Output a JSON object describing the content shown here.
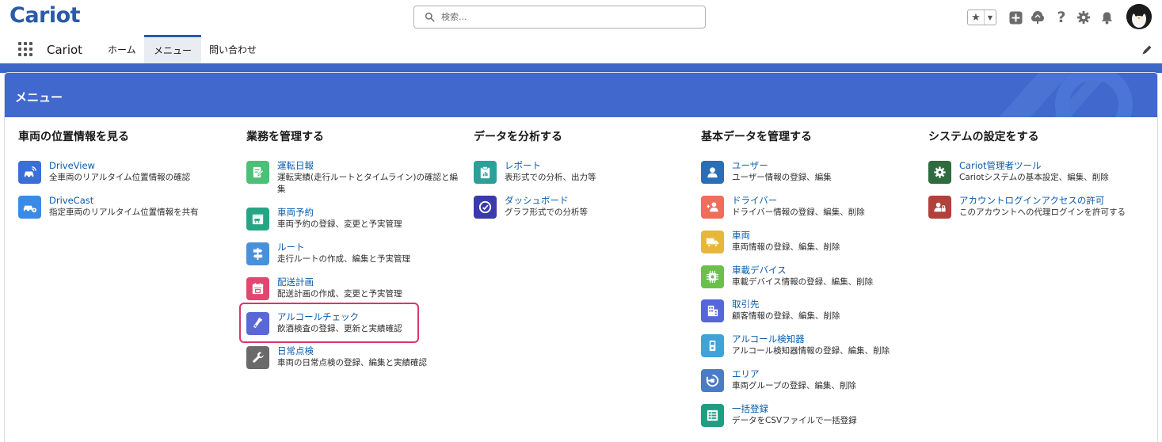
{
  "header": {
    "logo_text": "Cariot",
    "search_placeholder": "検索..."
  },
  "nav": {
    "app_name": "Cariot",
    "tabs": [
      {
        "label": "ホーム"
      },
      {
        "label": "メニュー",
        "active": true
      },
      {
        "label": "問い合わせ"
      }
    ]
  },
  "page": {
    "title": "メニュー"
  },
  "columns": [
    {
      "title": "車両の位置情報を見る",
      "items": [
        {
          "label": "DriveView",
          "desc": "全車両のリアルタイム位置情報の確認",
          "icon": "car-signal-icon",
          "color": "#3b6fd8"
        },
        {
          "label": "DriveCast",
          "desc": "指定車両のリアルタイム位置情報を共有",
          "icon": "car-share-icon",
          "color": "#3a8be6"
        }
      ]
    },
    {
      "title": "業務を管理する",
      "items": [
        {
          "label": "運転日報",
          "desc": "運転実績(走行ルートとタイムライン)の確認と編集",
          "icon": "report-edit-icon",
          "color": "#4bc076"
        },
        {
          "label": "車両予約",
          "desc": "車両予約の登録、変更と予実管理",
          "icon": "calendar-car-icon",
          "color": "#26a586"
        },
        {
          "label": "ルート",
          "desc": "走行ルートの作成、編集と予実管理",
          "icon": "route-sign-icon",
          "color": "#4a90d9"
        },
        {
          "label": "配送計画",
          "desc": "配送計画の作成、変更と予実管理",
          "icon": "calendar-icon",
          "color": "#e3466f"
        },
        {
          "label": "アルコールチェック",
          "desc": "飲酒検査の登録、更新と実績確認",
          "icon": "alcohol-tester-icon",
          "color": "#5a68d6"
        },
        {
          "label": "日常点検",
          "desc": "車両の日常点検の登録、編集と実績確認",
          "icon": "wrench-icon",
          "color": "#6a6a6a"
        }
      ]
    },
    {
      "title": "データを分析する",
      "items": [
        {
          "label": "レポート",
          "desc": "表形式での分析、出力等",
          "icon": "report-clipboard-icon",
          "color": "#2aa198"
        },
        {
          "label": "ダッシュボード",
          "desc": "グラフ形式での分析等",
          "icon": "gauge-icon",
          "color": "#3a3aa8"
        }
      ]
    },
    {
      "title": "基本データを管理する",
      "items": [
        {
          "label": "ユーザー",
          "desc": "ユーザー情報の登録、編集",
          "icon": "user-icon",
          "color": "#2a6eb8"
        },
        {
          "label": "ドライバー",
          "desc": "ドライバー情報の登録、編集、削除",
          "icon": "driver-icon",
          "color": "#ef6e5a"
        },
        {
          "label": "車両",
          "desc": "車両情報の登録、編集、削除",
          "icon": "truck-icon",
          "color": "#e8b73a"
        },
        {
          "label": "車載デバイス",
          "desc": "車載デバイス情報の登録、編集、削除",
          "icon": "chip-icon",
          "color": "#6cc04a"
        },
        {
          "label": "取引先",
          "desc": "顧客情報の登録、編集、削除",
          "icon": "building-icon",
          "color": "#5667d8"
        },
        {
          "label": "アルコール検知器",
          "desc": "アルコール検知器情報の登録、編集、削除",
          "icon": "detector-icon",
          "color": "#3fa3d8"
        },
        {
          "label": "エリア",
          "desc": "車両グループの登録、編集、削除",
          "icon": "area-icon",
          "color": "#4a7cc6"
        },
        {
          "label": "一括登録",
          "desc": "データをCSVファイルで一括登録",
          "icon": "bulk-import-icon",
          "color": "#1f9e83"
        }
      ]
    },
    {
      "title": "システムの設定をする",
      "items": [
        {
          "label": "Cariot管理者ツール",
          "desc": "Cariotシステムの基本設定、編集、削除",
          "icon": "gear-icon",
          "color": "#2f6b3e"
        },
        {
          "label": "アカウントログインアクセスの許可",
          "desc": "このアカウントへの代理ログインを許可する",
          "icon": "user-lock-icon",
          "color": "#b2413c"
        }
      ]
    }
  ]
}
